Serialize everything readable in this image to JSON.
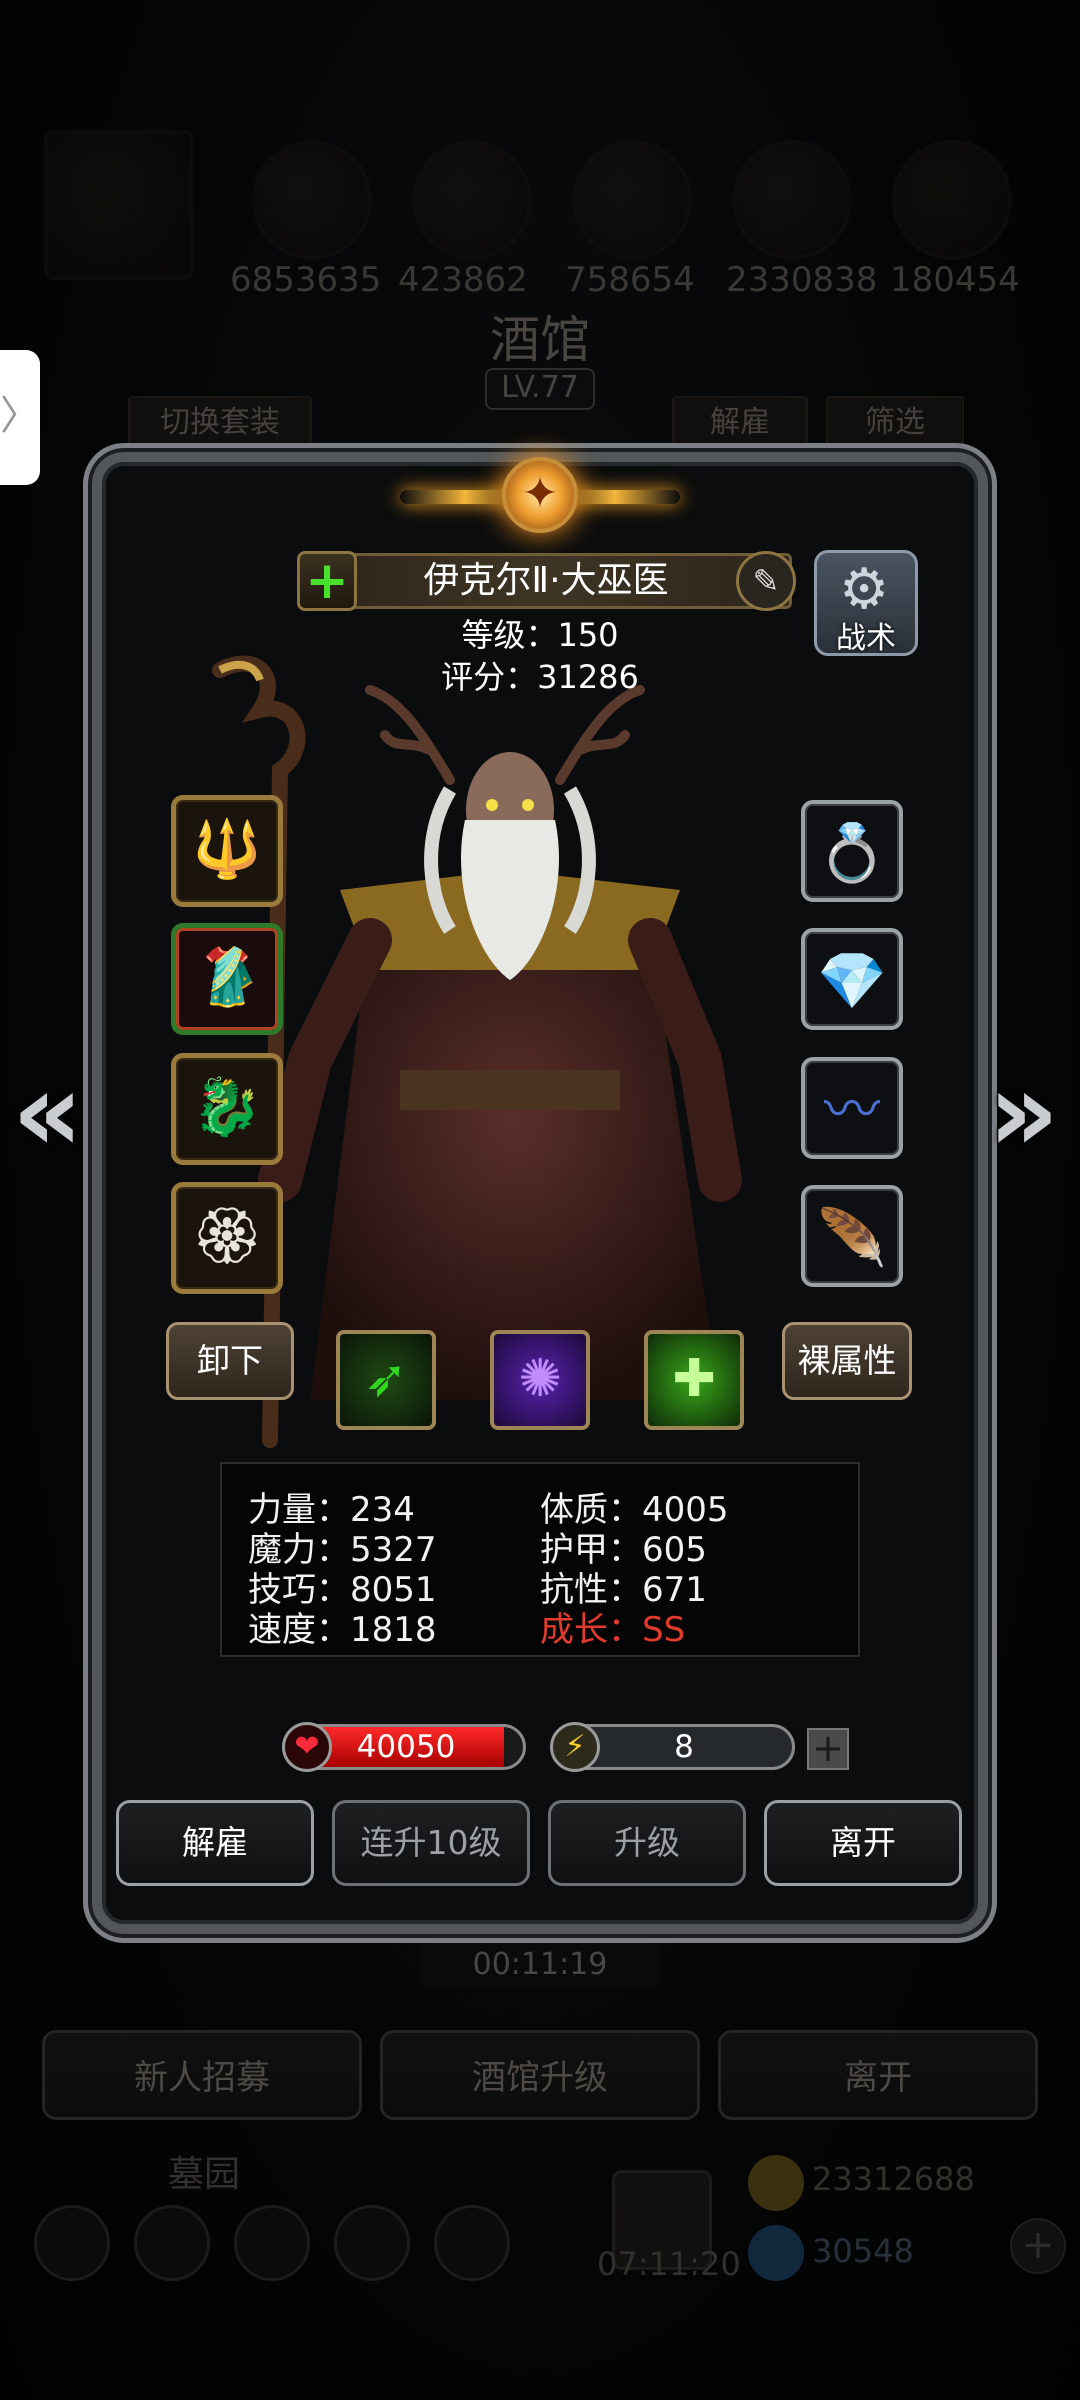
{
  "background": {
    "resource_numbers": [
      "6853635",
      "423862",
      "758654",
      "2330838",
      "180454"
    ],
    "title": "酒馆",
    "level": "LV.77",
    "switch_outfit": "切换套装",
    "dismiss_tab": "解雇",
    "filter_tab": "筛选",
    "timer": "00:11:19",
    "buttons": [
      "新人招募",
      "酒馆升级",
      "离开"
    ],
    "cemetery": "墓园",
    "chest_timer": "07:11:20",
    "gold": "23312688",
    "gems": "30548"
  },
  "hero": {
    "name": "伊克尔Ⅱ·大巫医",
    "level_text": "等级：150",
    "score_text": "评分：31286",
    "tactic_label": "战术"
  },
  "equipment": {
    "left": [
      {
        "name": "staff-item",
        "icon": "🔱",
        "rarity": "gold"
      },
      {
        "name": "robe-item",
        "icon": "🥻",
        "rarity": "green"
      },
      {
        "name": "beast-item",
        "icon": "🐉",
        "rarity": "gold"
      },
      {
        "name": "amulet-item",
        "icon": "🏵",
        "rarity": "gold"
      }
    ],
    "right": [
      {
        "name": "crown-item",
        "icon": "💍",
        "rarity": "silver"
      },
      {
        "name": "crystal-item",
        "icon": "💎",
        "rarity": "silver"
      },
      {
        "name": "whip-item",
        "icon": "〰",
        "rarity": "silver"
      },
      {
        "name": "wing-item",
        "icon": "🪶",
        "rarity": "silver"
      }
    ]
  },
  "actions": {
    "unequip": "卸下",
    "base_attributes": "裸属性"
  },
  "skills": [
    {
      "name": "green-slash-skill",
      "icon": "➶",
      "color": "#2fd81e"
    },
    {
      "name": "purple-storm-skill",
      "icon": "✺",
      "color": "#9a3cf0"
    },
    {
      "name": "heal-skill",
      "icon": "✚",
      "color": "#7cff3a"
    }
  ],
  "stats": {
    "strength": {
      "label": "力量：",
      "value": "234"
    },
    "magic": {
      "label": "魔力：",
      "value": "5327"
    },
    "skill": {
      "label": "技巧：",
      "value": "8051"
    },
    "speed": {
      "label": "速度：",
      "value": "1818"
    },
    "constitution": {
      "label": "体质：",
      "value": "4005"
    },
    "armor": {
      "label": "护甲：",
      "value": "605"
    },
    "resistance": {
      "label": "抗性：",
      "value": "671"
    },
    "growth": {
      "label": "成长：",
      "value": "SS"
    }
  },
  "vitals": {
    "hp": "40050",
    "hp_fill": 0.92,
    "energy": "8",
    "energy_fill": 0.1
  },
  "footer": {
    "dismiss": "解雇",
    "level_up_10": "连升10级",
    "level_up": "升级",
    "leave": "离开"
  },
  "colors": {
    "growth": "#e23a2c",
    "hp": "#e01010",
    "energy": "#e8c83a",
    "crest_glow": "#f4a93a"
  }
}
